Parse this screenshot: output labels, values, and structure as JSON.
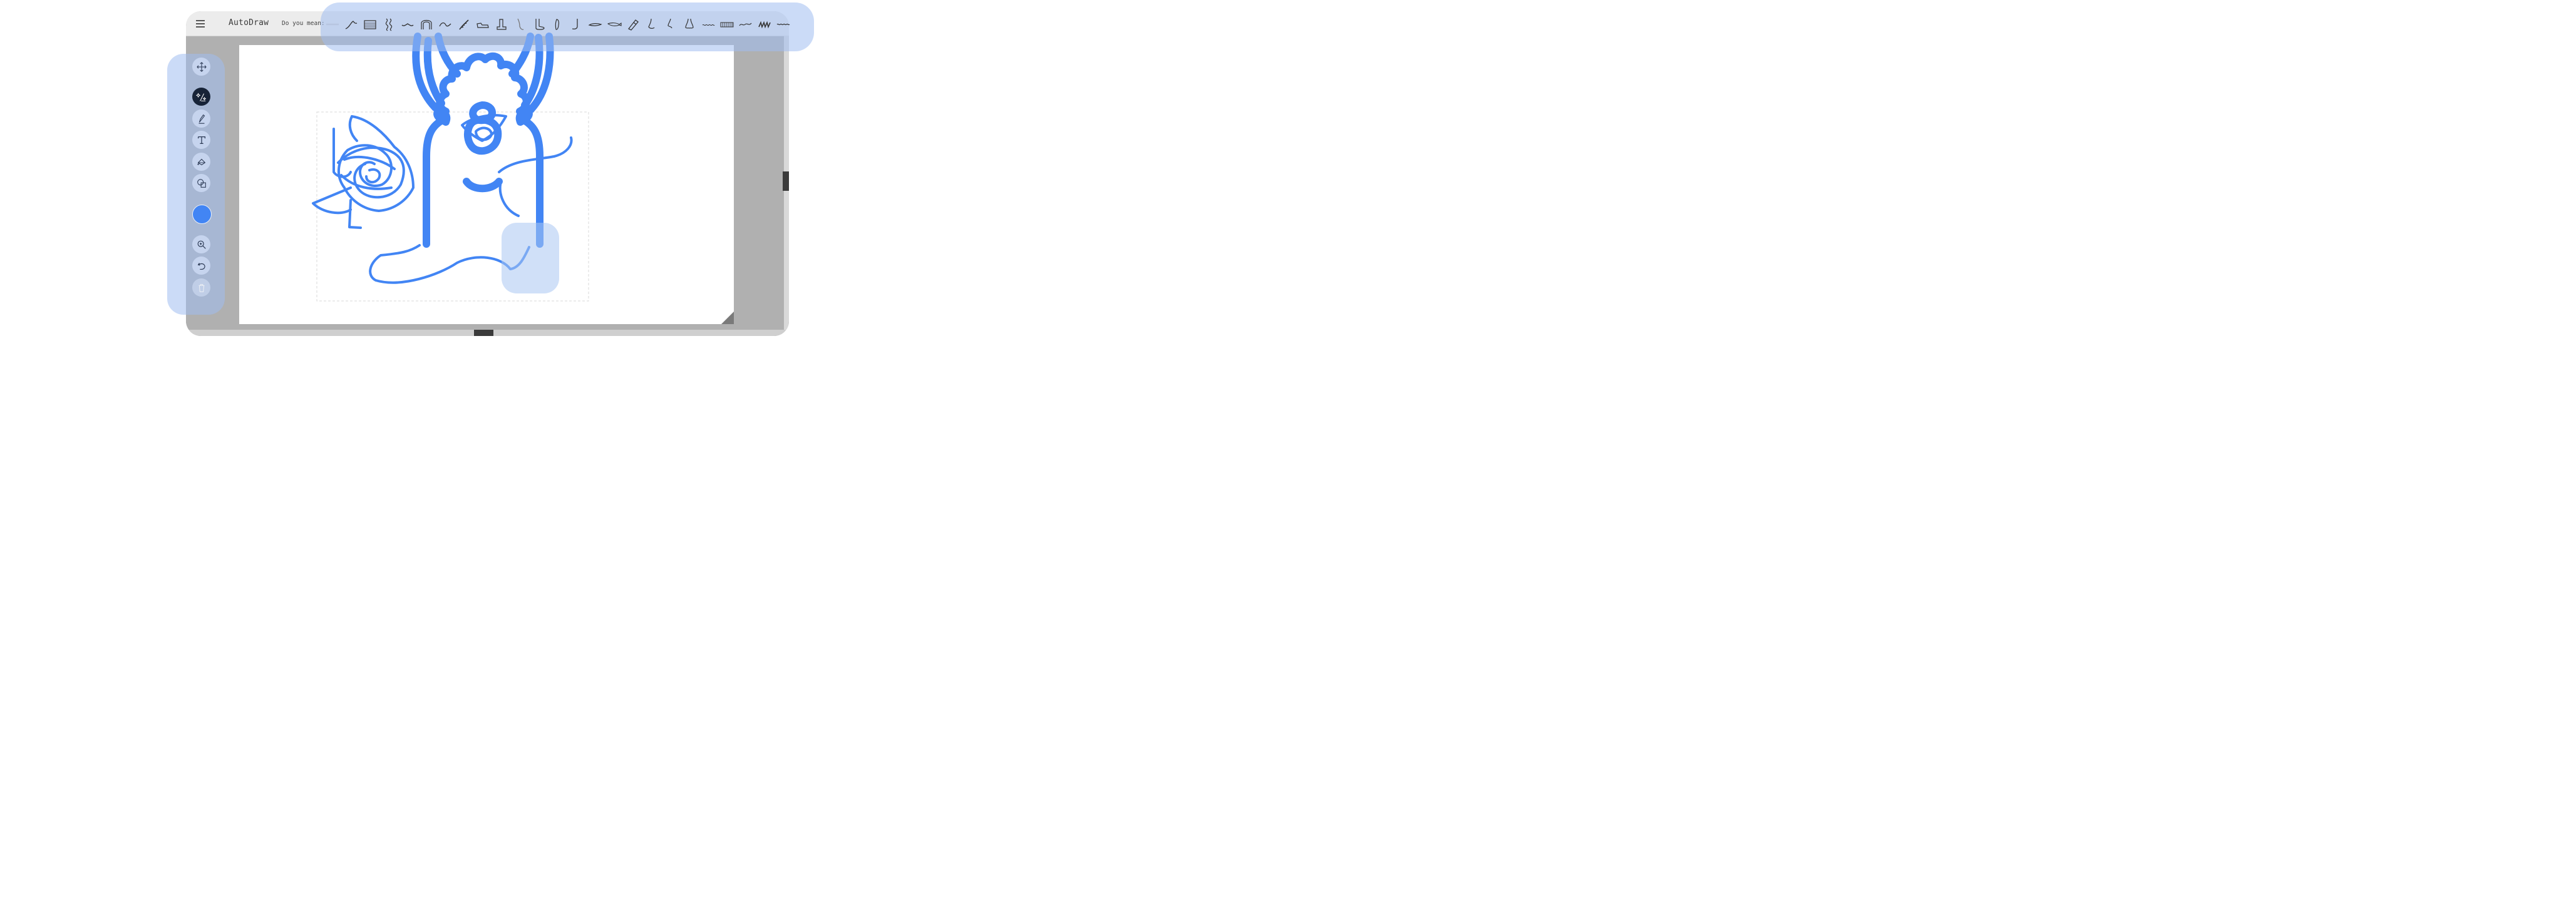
{
  "app": {
    "title": "AutoDraw",
    "suggest_label": "Do you mean:"
  },
  "suggestions": [
    {
      "icon": "dash-scribble-icon"
    },
    {
      "icon": "wave-line-icon"
    },
    {
      "icon": "water-grid-icon"
    },
    {
      "icon": "squiggle-icon"
    },
    {
      "icon": "mustache-icon"
    },
    {
      "icon": "arch-icon"
    },
    {
      "icon": "curvy-line-icon"
    },
    {
      "icon": "feather-icon"
    },
    {
      "icon": "shoe-icon"
    },
    {
      "icon": "chair-icon"
    },
    {
      "icon": "finger-icon"
    },
    {
      "icon": "foot-icon"
    },
    {
      "icon": "footprint-icon"
    },
    {
      "icon": "leg-icon"
    },
    {
      "icon": "whale-icon"
    },
    {
      "icon": "fish-icon"
    },
    {
      "icon": "lipstick-icon"
    },
    {
      "icon": "nose-icon"
    },
    {
      "icon": "face-profile-icon"
    },
    {
      "icon": "nostril-icon"
    },
    {
      "icon": "ripple-icon"
    },
    {
      "icon": "keyboard-icon"
    },
    {
      "icon": "snake-icon"
    },
    {
      "icon": "zigzag-icon"
    },
    {
      "icon": "wavy-bar-icon"
    }
  ],
  "tools": [
    {
      "name": "move-tool",
      "icon": "move-icon",
      "state": "normal"
    },
    {
      "name": "autodraw-tool",
      "icon": "autodraw-icon",
      "state": "active"
    },
    {
      "name": "draw-tool",
      "icon": "pencil-icon",
      "state": "normal"
    },
    {
      "name": "text-tool",
      "icon": "text-icon",
      "state": "normal"
    },
    {
      "name": "fill-tool",
      "icon": "fill-icon",
      "state": "normal"
    },
    {
      "name": "shape-tool",
      "icon": "shapes-icon",
      "state": "normal"
    },
    {
      "name": "zoom-tool",
      "icon": "zoom-icon",
      "state": "normal"
    },
    {
      "name": "undo-tool",
      "icon": "undo-icon",
      "state": "normal"
    },
    {
      "name": "delete-tool",
      "icon": "trash-icon",
      "state": "disabled"
    }
  ],
  "colors": {
    "stroke": "#4285f4",
    "active_tool": "#172337",
    "tool_bg": "#c6d4ee",
    "highlight": "#a0bef0",
    "canvas_bg": "#ffffff",
    "workspace_bg": "#b0b0b0"
  },
  "current_color": "#4285f4"
}
